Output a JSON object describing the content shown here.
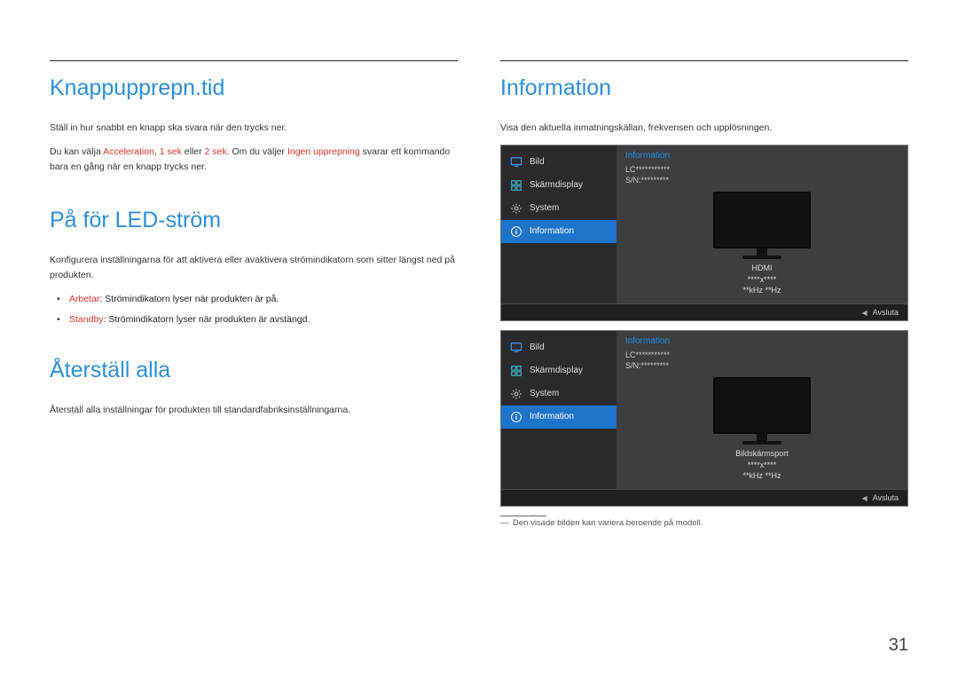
{
  "page_number": "31",
  "left": {
    "sec1": {
      "heading": "Knappupprepn.tid",
      "p1_a": "Ställ in hur snabbt en knapp ska svara när den trycks ner.",
      "p2_a": "Du kan välja ",
      "p2_b": "Acceleration",
      "p2_c": ", ",
      "p2_d": "1 sek",
      "p2_e": " eller ",
      "p2_f": "2 sek",
      "p2_g": ". Om du väljer ",
      "p2_h": "Ingen upprepning",
      "p2_i": " svarar ett kommando bara en gång när en knapp trycks ner."
    },
    "sec2": {
      "heading": "På för LED-ström",
      "p1": "Konfigurera inställningarna för att aktivera eller avaktivera strömindikatorn som sitter längst ned på produkten.",
      "b1_red": "Arbetar",
      "b1_rest": ": Strömindikatorn lyser när produkten är på.",
      "b2_red": "Standby",
      "b2_rest": ": Strömindikatorn lyser när produkten är avstängd."
    },
    "sec3": {
      "heading": "Återställ alla",
      "p1": "Återställ alla inställningar för produkten till standardfabriksinställningarna."
    }
  },
  "right": {
    "heading": "Information",
    "p1": "Visa den aktuella inmatningskällan, frekvensen och upplösningen.",
    "footnote": "Den visade bilden kan variera beroende på modell.",
    "footnote_dash": "―"
  },
  "osd_common": {
    "side": {
      "bild": "Bild",
      "skarmdisplay": "Skärmdisplay",
      "system": "System",
      "information": "Information"
    },
    "title": "Information",
    "meta_line1": "LC***********",
    "meta_line2": "S/N:*********",
    "spec2": "****x****",
    "spec3": "**kHz **Hz",
    "exit_label": "Avsluta"
  },
  "osd1": {
    "spec1": "HDMI"
  },
  "osd2": {
    "spec1": "Bildskärmsport"
  }
}
